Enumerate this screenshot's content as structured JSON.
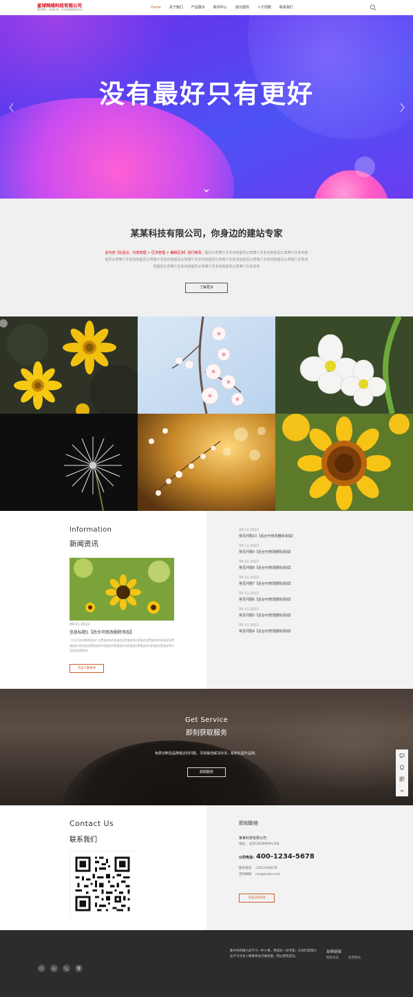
{
  "header": {
    "logo_title": "星球网络科技有限公司",
    "logo_subtitle": "做好服务 · 传递价值 · 专业的网络服务平台",
    "nav": [
      "Home",
      "关于我们",
      "产品展示",
      "新闻中心",
      "成功案例",
      "人才招聘",
      "联系我们"
    ],
    "active_index": 0
  },
  "banner": {
    "title": "没有最好只有更好"
  },
  "intro": {
    "title": "某某科技有限公司，你身边的建站专家",
    "text_red": "此内容【在后台：内容管理 > 区块管理 > 编辑区块】进行修改，",
    "text_rest": "首页公司简介文本内容首页公司简介文本内容首页公司简介文本内容首页公司简介文本内容首页公司简介文本内容首页公司简介文本内容首页公司简介文本内容首页公司简介文本内容首页公司简介文本内容首页公司简介文本内容首页公司简介文本内容首页公司简介文本内容",
    "button": "了解更多"
  },
  "gallery": {
    "items": [
      "黄色雏菊",
      "樱花",
      "白色花朵",
      "蒲公英",
      "金色花枝",
      "向日葵"
    ]
  },
  "news": {
    "title_en": "Information",
    "title_cn": "新闻资讯",
    "featured": {
      "date": "09-11-2022",
      "title": "信息标题1【后台可修改删除添加】",
      "desc": "【后台可修改删除添加】设置描述和内容描述设置描述和内容描述设置描述和内容描述设置描述和内容描述设置描述和内容描述设置描述和内容描述设置描述和内容描述设置描述和内容描述设置描述...",
      "button": "点击了解更多"
    },
    "list": [
      {
        "date": "09-11-2022",
        "title": "常见问题10【后台可修改删除添加】"
      },
      {
        "date": "09-11-2022",
        "title": "常见问题9【后台可修改删除添加】"
      },
      {
        "date": "09-11-2022",
        "title": "常见问题8【后台可修改删除添加】"
      },
      {
        "date": "09-11-2022",
        "title": "常见问题7【后台可修改删除添加】"
      },
      {
        "date": "09-11-2022",
        "title": "常见问题6【后台可修改删除添加】"
      },
      {
        "date": "09-11-2022",
        "title": "常见问题5【后台可修改删除添加】"
      },
      {
        "date": "09-11-2022",
        "title": "常见问题4【后台可修改删除添加】"
      }
    ]
  },
  "service": {
    "title_en": "Get Service",
    "title_cn": "即刻获取服务",
    "desc": "免费诊断您品牌最近的问题，寻找最佳解决办法，系统化提升品牌。",
    "button": "获取服务"
  },
  "side_tools": [
    "message-icon",
    "qq-icon",
    "qrcode-icon",
    "back-to-top-icon"
  ],
  "contact": {
    "title_en": "Contact Us",
    "title_cn": "联系我们",
    "heading": "即刻联络",
    "company": "某某科技有限公司",
    "address": "地址：  北京CBD商务中心6号",
    "phone_label": "公司电话:",
    "phone": "400-1234-5678",
    "mobile": "服务电话：  13012345678",
    "email": "咨询邮箱：  ceo@baidu.com",
    "button": "点击QQ咨询"
  },
  "footer": {
    "text": "集中你的精力去学习一件小事，用成功一份专家；比你仍是精力去学习许多小事要更加可做到期，用过游戏成功。",
    "links_title": "友情链接",
    "links": [
      "网站优选",
      "免费建站"
    ],
    "icons": [
      "wechat-icon",
      "weibo-icon",
      "phone-icon",
      "location-icon"
    ]
  }
}
